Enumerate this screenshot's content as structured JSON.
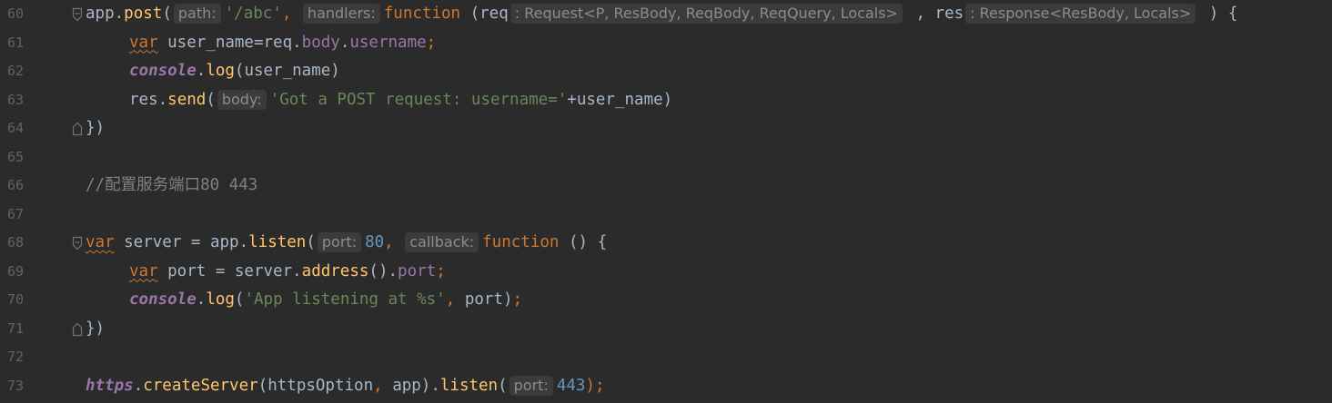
{
  "editor": {
    "theme_colors": {
      "background": "#2b2b2b",
      "line_number": "#606366",
      "keyword": "#cc7832",
      "string": "#6a8759",
      "number": "#6897bb",
      "property": "#9876aa",
      "function": "#ffc66d",
      "text": "#a9b7c6",
      "comment": "#808080",
      "hint_bg": "#3b3b3b",
      "hint_text": "#8c8c8c"
    },
    "lines": [
      {
        "number": "60",
        "t": [
          "app.",
          "post",
          "(",
          "path:",
          "'/abc'",
          ", ",
          "handlers:",
          "function",
          " (req",
          ": Request<P, ResBody, ReqBody, ReqQuery, Locals>",
          " , res",
          ": Response<ResBody, Locals>",
          " ) {"
        ]
      },
      {
        "number": "61",
        "t": [
          "var",
          " user_name=req.",
          "body",
          ".",
          "username",
          ";"
        ]
      },
      {
        "number": "62",
        "t": [
          "console",
          ".",
          "log",
          "(user_name)"
        ]
      },
      {
        "number": "63",
        "t": [
          "res.",
          "send",
          "(",
          "body:",
          "'Got a POST request: username='",
          "+user_name)"
        ]
      },
      {
        "number": "64",
        "t": [
          "})"
        ]
      },
      {
        "number": "65",
        "t": []
      },
      {
        "number": "66",
        "t": [
          "//配置服务端口80 443"
        ]
      },
      {
        "number": "67",
        "t": []
      },
      {
        "number": "68",
        "t": [
          "var",
          " server = app.",
          "listen",
          "(",
          "port:",
          "80",
          ", ",
          "callback:",
          "function",
          " () {"
        ]
      },
      {
        "number": "69",
        "t": [
          "var",
          " port = server.",
          "address",
          "().",
          "port",
          ";"
        ]
      },
      {
        "number": "70",
        "t": [
          "console",
          ".",
          "log",
          "(",
          "'App listening at %s'",
          ", ",
          "port)",
          ";"
        ]
      },
      {
        "number": "71",
        "t": [
          "})"
        ]
      },
      {
        "number": "72",
        "t": []
      },
      {
        "number": "73",
        "t": [
          "https",
          ".",
          "createServer",
          "(httpsOption",
          ", ",
          "app).",
          "listen",
          "(",
          "port:",
          "443",
          ");"
        ]
      }
    ]
  }
}
